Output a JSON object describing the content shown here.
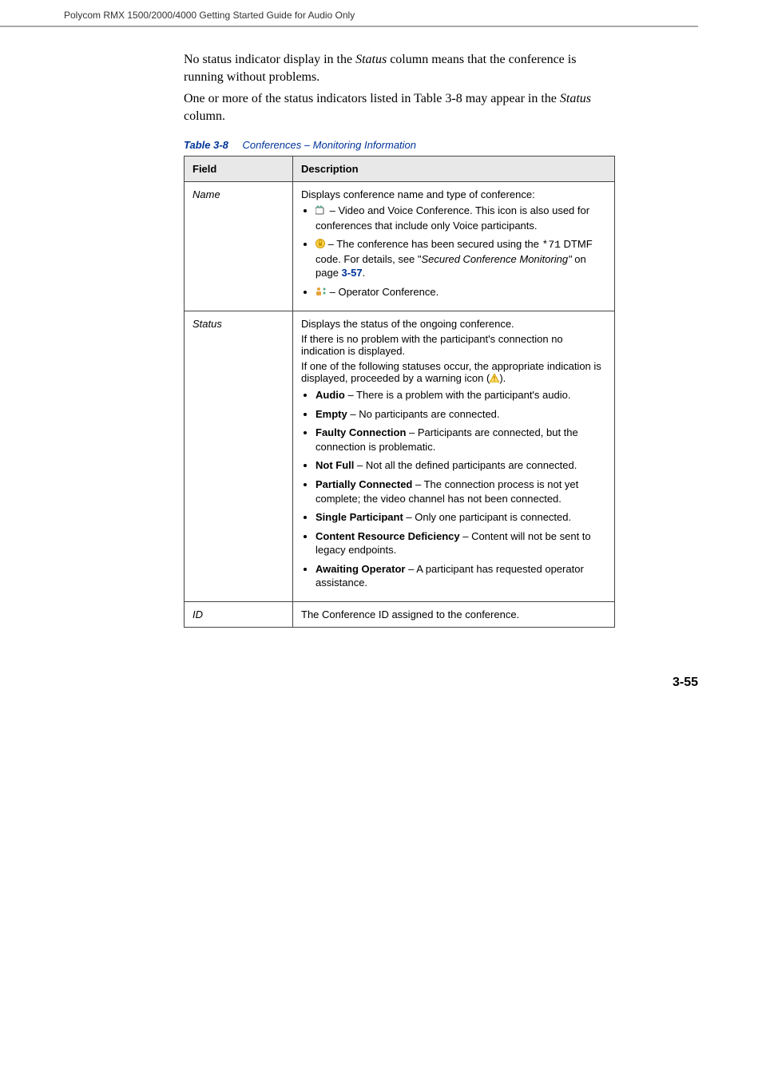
{
  "header": {
    "running": "Polycom RMX 1500/2000/4000 Getting Started Guide for Audio Only"
  },
  "intro": {
    "p1a": "No status indicator display in the ",
    "p1_em": "Status",
    "p1b": " column means that the conference is running without problems.",
    "p2a": "One or more of the status indicators listed in Table 3-8 may appear in the ",
    "p2_em": "Status",
    "p2b": " column."
  },
  "caption": {
    "label": "Table 3-8",
    "text": "Conferences – Monitoring Information"
  },
  "table": {
    "head_field": "Field",
    "head_desc": "Description",
    "rows": {
      "name": {
        "field": "Name",
        "intro": "Displays conference name and type of conference:",
        "b1": " – Video and Voice Conference. This icon is also used for conferences that include only Voice participants.",
        "b2a": " – The conference has been secured using the ",
        "b2_code": "*71",
        "b2b": " DTMF code. For details, see \"",
        "b2_em": "Secured Conference Monitoring\"",
        "b2c": " on page ",
        "b2_link": "3-57",
        "b2d": ".",
        "b3": " – Operator Conference."
      },
      "status": {
        "field": "Status",
        "intro1": "Displays the status of the ongoing conference.",
        "intro2": "If there is no problem with the participant's connection no indication is displayed.",
        "intro3a": "If one of the following statuses occur, the appropriate indication is displayed, proceeded by a warning icon (",
        "intro3b": ").",
        "b1_strong": "Audio",
        "b1_rest": " – There is a problem with the participant's audio.",
        "b2_strong": "Empty",
        "b2_rest": " – No participants are connected.",
        "b3_strong": "Faulty Connection",
        "b3_rest": " – Participants are connected, but the connection is problematic.",
        "b4_strong": "Not Full",
        "b4_rest": " – Not all the defined participants are connected.",
        "b5_strong": "Partially Connected",
        "b5_rest": " – The connection process is not yet complete; the video channel has not been connected.",
        "b6_strong": "Single Participant",
        "b6_rest": " – Only one participant is connected.",
        "b7_strong": "Content Resource Deficiency",
        "b7_rest": " – Content will not be sent to legacy endpoints.",
        "b8_strong": "Awaiting Operator",
        "b8_rest": " – A participant has requested operator assistance."
      },
      "id": {
        "field": "ID",
        "desc": "The Conference ID assigned to the conference."
      }
    }
  },
  "footer": {
    "page": "3-55"
  }
}
